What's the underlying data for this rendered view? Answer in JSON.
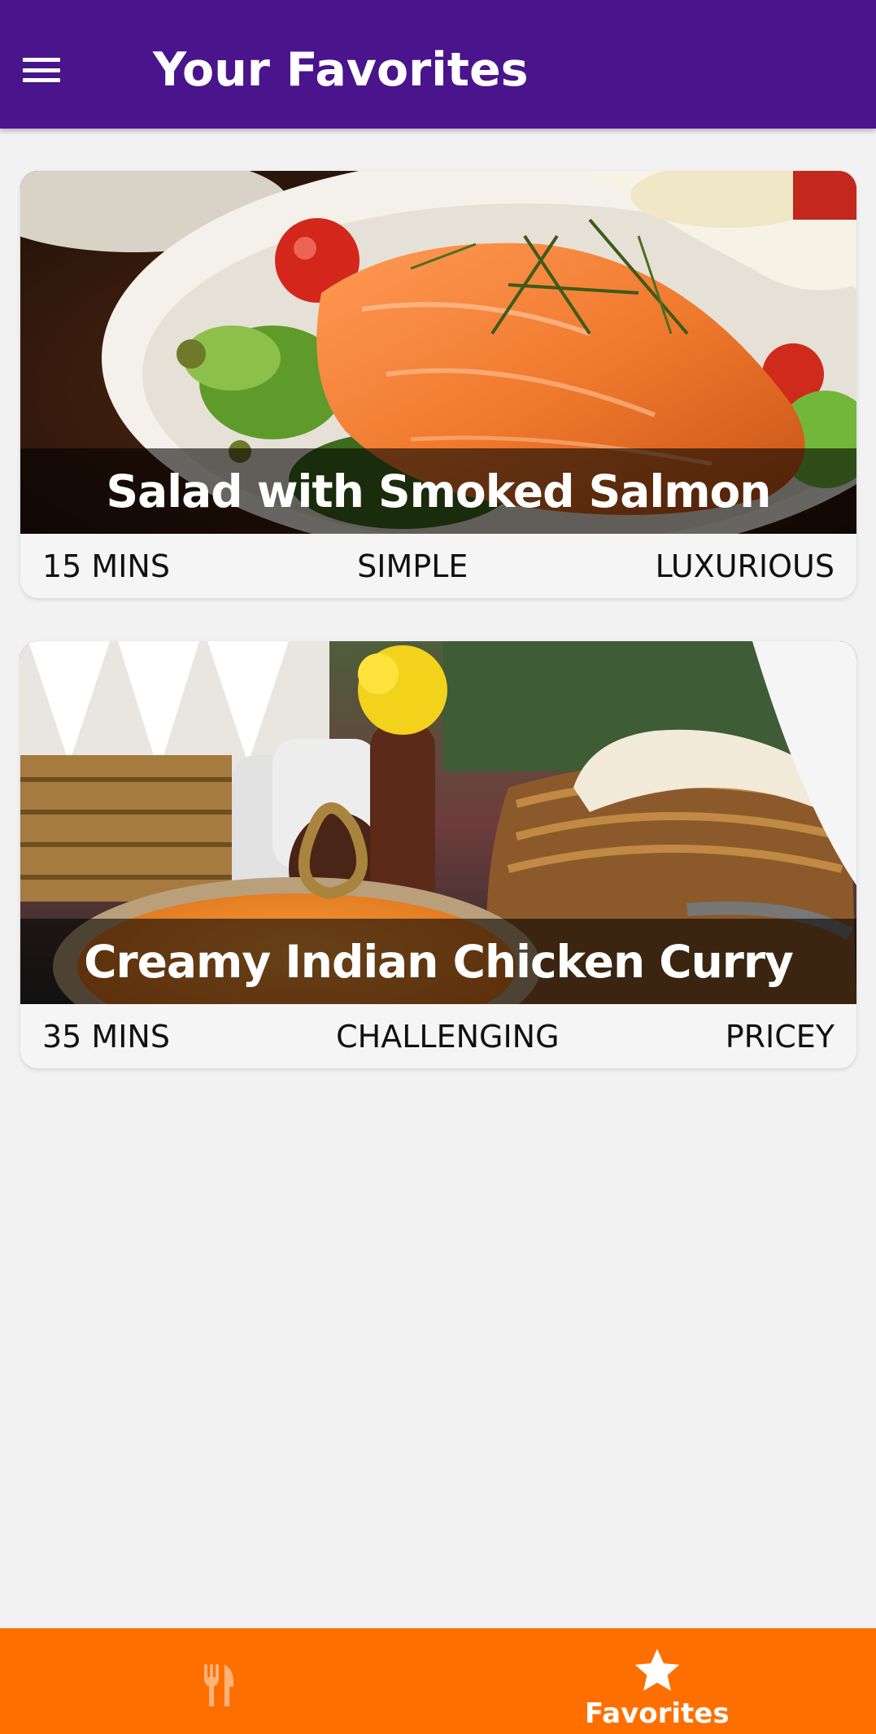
{
  "app_bar": {
    "title": "Your Favorites",
    "menu_icon": "hamburger-menu-icon",
    "background_color": "#4a148c"
  },
  "meals": [
    {
      "title": "Salad with Smoked Salmon",
      "duration": "15 MINS",
      "complexity": "SIMPLE",
      "affordability": "LUXURIOUS"
    },
    {
      "title": "Creamy Indian Chicken Curry",
      "duration": "35 MINS",
      "complexity": "CHALLENGING",
      "affordability": "PRICEY"
    }
  ],
  "bottom_nav": {
    "background_color": "#ff6f00",
    "tabs": [
      {
        "icon": "restaurant-icon",
        "label": "",
        "active": false
      },
      {
        "icon": "star-icon",
        "label": "Favorites",
        "active": true
      }
    ]
  }
}
